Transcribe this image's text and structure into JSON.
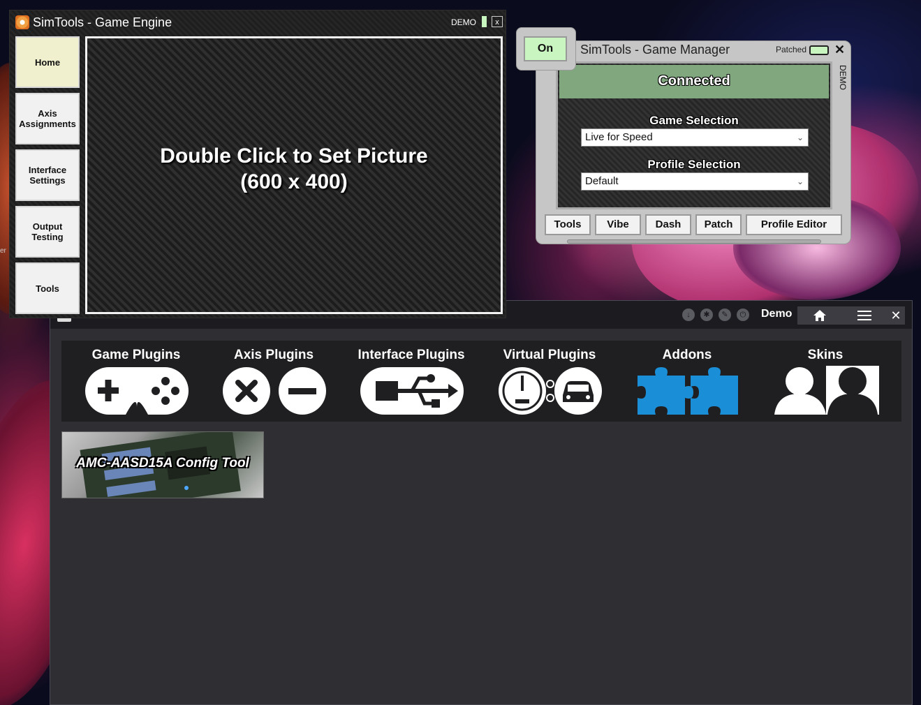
{
  "engine": {
    "title": "SimTools - Game Engine",
    "demo": "DEMO",
    "close": "x",
    "sidebar": [
      {
        "label": "Home"
      },
      {
        "label": "Axis Assignments"
      },
      {
        "label": "Interface Settings"
      },
      {
        "label": "Output Testing"
      },
      {
        "label": "Tools"
      }
    ],
    "picture_line1": "Double Click to Set Picture",
    "picture_line2": "(600 x 400)"
  },
  "manager": {
    "on": "On",
    "title": "SimTools - Game Manager",
    "patched": "Patched",
    "close": "✕",
    "side_demo": "DEMO",
    "status": "Connected",
    "game_selection_label": "Game Selection",
    "game_selection_value": "Live for Speed",
    "profile_selection_label": "Profile Selection",
    "profile_selection_value": "Default",
    "buttons": [
      {
        "label": "Tools"
      },
      {
        "label": "Vibe"
      },
      {
        "label": "Dash"
      },
      {
        "label": "Patch"
      },
      {
        "label": "Profile Editor"
      }
    ]
  },
  "main": {
    "demo": "Demo",
    "home_icon": "home-icon",
    "menu_icon": "menu-icon",
    "close": "✕",
    "plugins": [
      {
        "label": "Game Plugins",
        "icon": "gamepad-icon"
      },
      {
        "label": "Axis Plugins",
        "icon": "axis-icon"
      },
      {
        "label": "Interface Plugins",
        "icon": "usb-icon"
      },
      {
        "label": "Virtual Plugins",
        "icon": "gauge-car-icon"
      },
      {
        "label": "Addons",
        "icon": "puzzle-icon"
      },
      {
        "label": "Skins",
        "icon": "user-icon"
      }
    ],
    "addon_tile": "AMC-AASD15A Config Tool"
  },
  "colors": {
    "accent_blue": "#1a8fd8",
    "connected_green": "#80a77e",
    "on_green": "#c8f5c0"
  }
}
